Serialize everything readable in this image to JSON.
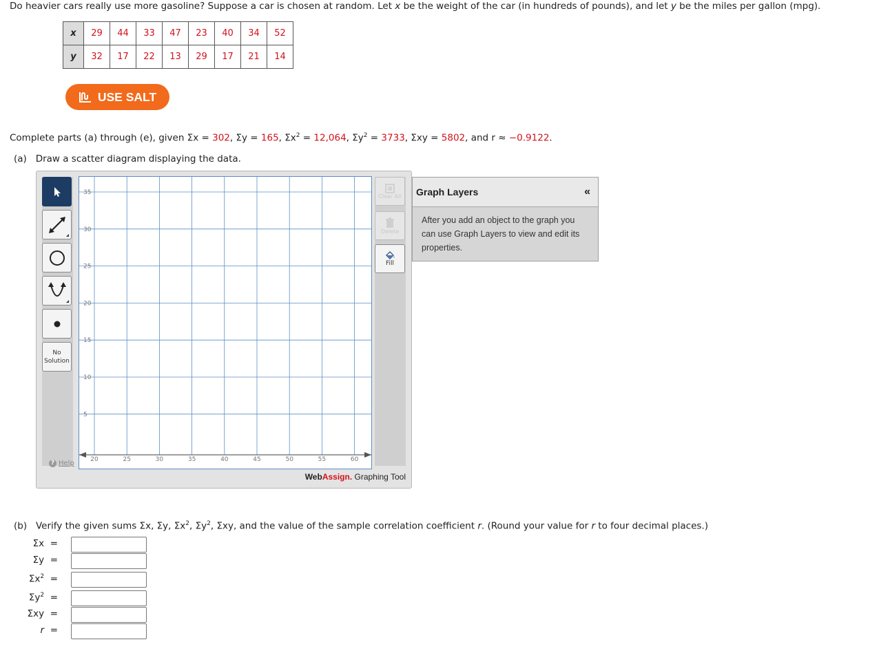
{
  "intro": {
    "p1": "Do heavier cars really use more gasoline? Suppose a car is chosen at random. Let ",
    "x": "x",
    "p2": " be the weight of the car (in hundreds of pounds), and let ",
    "y": "y",
    "p3": " be the miles per gallon (mpg)."
  },
  "table": {
    "x_header": "x",
    "y_header": "y",
    "x_values": [
      "29",
      "44",
      "33",
      "47",
      "23",
      "40",
      "34",
      "52"
    ],
    "y_values": [
      "32",
      "17",
      "22",
      "13",
      "29",
      "17",
      "21",
      "14"
    ]
  },
  "salt_button": {
    "label": "USE SALT"
  },
  "given": {
    "lead": "Complete parts (a) through (e), given ",
    "sx_lbl": "Σx = ",
    "sx": "302",
    "sy_lbl": ", Σy = ",
    "sy": "165",
    "sx2_lbl": ", Σx",
    "sx2_eq": " = ",
    "sx2": "12,064",
    "sy2_lbl": ", Σy",
    "sy2_eq": " = ",
    "sy2": "3733",
    "sxy_lbl": ", Σxy = ",
    "sxy": "5802",
    "r_lbl": ", and r ≈ ",
    "r": "−0.9122",
    "end": "."
  },
  "part_a": {
    "letter": "(a)",
    "text": "Draw a scatter diagram displaying the data."
  },
  "graph": {
    "x_ticks": [
      "20",
      "25",
      "30",
      "35",
      "40",
      "45",
      "50",
      "55",
      "60"
    ],
    "y_ticks": [
      "35",
      "30",
      "25",
      "20",
      "15",
      "10",
      "5"
    ],
    "no_solution": [
      "No",
      "Solution"
    ],
    "help": "Help",
    "clear_all": "Clear All",
    "delete": "Delete",
    "fill": "Fill",
    "brand_web": "Web",
    "brand_assign": "Assign.",
    "brand_tool": " Graphing Tool",
    "colors": {
      "selected_tool": "#1d3c63",
      "grid": "#5b8ec4",
      "accent": "#f26a1b",
      "red": "#d0121b"
    }
  },
  "layers": {
    "title": "Graph Layers",
    "collapse": "«",
    "body": "After you add an object to the graph you can use Graph Layers to view and edit its properties."
  },
  "part_b": {
    "letter": "(b)",
    "text1": "Verify the given sums Σx, Σy, Σx",
    "text2": ", Σy",
    "text3": ", Σxy, and the value of the sample correlation coefficient ",
    "r": "r",
    "text4": ". (Round your value for ",
    "text5": " to four decimal places.)",
    "fields": {
      "sx": "Σx",
      "sy": "Σy",
      "sx2": "Σx",
      "sy2": "Σy",
      "sxy": "Σxy",
      "r": "r",
      "eq": "="
    },
    "sup": "2"
  }
}
